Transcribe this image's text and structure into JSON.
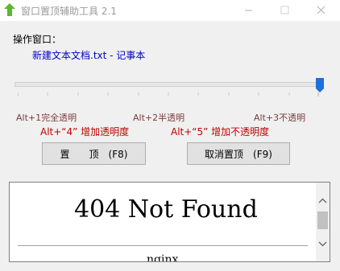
{
  "titlebar": {
    "title": "窗口置顶辅助工具 2.1",
    "icon": "green-up-arrow-icon",
    "buttons": [
      "minimize-icon",
      "maximize-icon",
      "close-icon"
    ]
  },
  "target": {
    "label": "操作窗口：",
    "window_name": "新建文本文档.txt - 记事本"
  },
  "transparency": {
    "level_fraction": 1.0,
    "levels": [
      "Alt+1完全透明",
      "Alt+2半透明",
      "Alt+3不透明"
    ],
    "hotkeys": [
      "Alt+“4” 增加透明度",
      "Alt+“5” 增加不透明度"
    ]
  },
  "buttons": {
    "pin": "置　　顶　(F8)",
    "unpin": "取消置顶　(F9)"
  },
  "viewer": {
    "heading": "404 Not Found",
    "server": "nginx"
  },
  "colors": {
    "window_name": "#0000c8",
    "hotkey_text": "#c00000",
    "level_text": "#7a3d3d",
    "slider_thumb": "#1e6fd9"
  }
}
